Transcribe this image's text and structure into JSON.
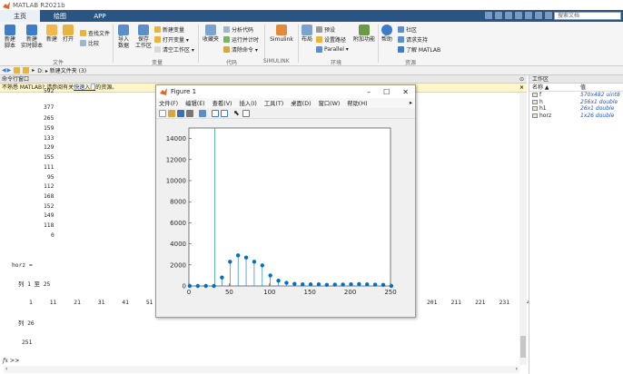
{
  "window": {
    "title": "MATLAB R2021b"
  },
  "tabs": [
    "主页",
    "绘图",
    "APP"
  ],
  "search_placeholder": "搜索文档",
  "ribbon": {
    "file": {
      "buttons": [
        "新建\n脚本",
        "新建\n实时脚本",
        "新建",
        "打开"
      ],
      "small": [
        "查找文件",
        "比较"
      ],
      "group": "文件"
    },
    "variable": {
      "buttons": [
        "导入\n数据",
        "保存\n工作区"
      ],
      "small": [
        "新建变量",
        "打开变量 ▾",
        "清空工作区 ▾"
      ],
      "group": "变量"
    },
    "code": {
      "buttons": [
        "收藏夹"
      ],
      "small": [
        "分析代码",
        "运行并计时",
        "清除命令 ▾"
      ],
      "group": "代码"
    },
    "simulink": {
      "buttons": [
        "Simulink"
      ],
      "group": "SIMULINK"
    },
    "env": {
      "buttons": [
        "布局",
        "附加功能"
      ],
      "small": [
        "预设",
        "设置路径",
        "Parallel ▾"
      ],
      "group": "环境"
    },
    "res": {
      "buttons": [
        "帮助"
      ],
      "small": [
        "社区",
        "请求支持",
        "了解 MATLAB"
      ],
      "group": "资源"
    }
  },
  "address": {
    "path": "D: ▸ 新建文件夹 (3)"
  },
  "command_window": {
    "title": "命令行窗口",
    "notice": "不熟悉 MATLAB? 请参阅有关",
    "notice_link": "快速入门",
    "notice_tail": "的资源。",
    "values": [
      "592",
      "377",
      "265",
      "159",
      "133",
      "129",
      "155",
      "111",
      "95",
      "112",
      "168",
      "152",
      "149",
      "118",
      "0"
    ],
    "horz_label": "horz =",
    "cols_1": "列 1 至 25",
    "row_left": "1     11     21     31     41     51     61",
    "row_right": "201    211    221    231    241",
    "cols_2": "列 26",
    "last_val": "251",
    "prompt": "fx >>"
  },
  "workspace": {
    "title": "工作区",
    "col_name": "名称 ▲",
    "col_value": "值",
    "rows": [
      {
        "name": "f",
        "value": "570x482 uint8"
      },
      {
        "name": "h",
        "value": "256x1 double"
      },
      {
        "name": "h1",
        "value": "26x1 double"
      },
      {
        "name": "horz",
        "value": "1x26 double"
      }
    ]
  },
  "figure": {
    "title": "Figure 1",
    "menu": [
      "文件(F)",
      "编辑(E)",
      "查看(V)",
      "插入(I)",
      "工具(T)",
      "桌面(D)",
      "窗口(W)",
      "帮助(H)"
    ]
  },
  "chart_data": {
    "type": "scatter",
    "style": "stem",
    "x": [
      1,
      11,
      21,
      31,
      41,
      51,
      61,
      71,
      81,
      91,
      101,
      111,
      121,
      131,
      141,
      151,
      161,
      171,
      181,
      191,
      201,
      211,
      221,
      231,
      241,
      251
    ],
    "y": [
      0,
      0,
      0,
      0,
      800,
      2300,
      2900,
      2700,
      2300,
      1950,
      1000,
      500,
      300,
      200,
      150,
      150,
      150,
      100,
      120,
      130,
      160,
      180,
      150,
      120,
      100,
      0
    ],
    "vline_x": 32,
    "xlim": [
      0,
      250
    ],
    "ylim": [
      0,
      15000
    ],
    "xticks": [
      0,
      50,
      100,
      150,
      200,
      250
    ],
    "yticks": [
      0,
      2000,
      4000,
      6000,
      8000,
      10000,
      12000,
      14000
    ],
    "color": "#0072bd",
    "vline_color": "#3aa98c"
  }
}
